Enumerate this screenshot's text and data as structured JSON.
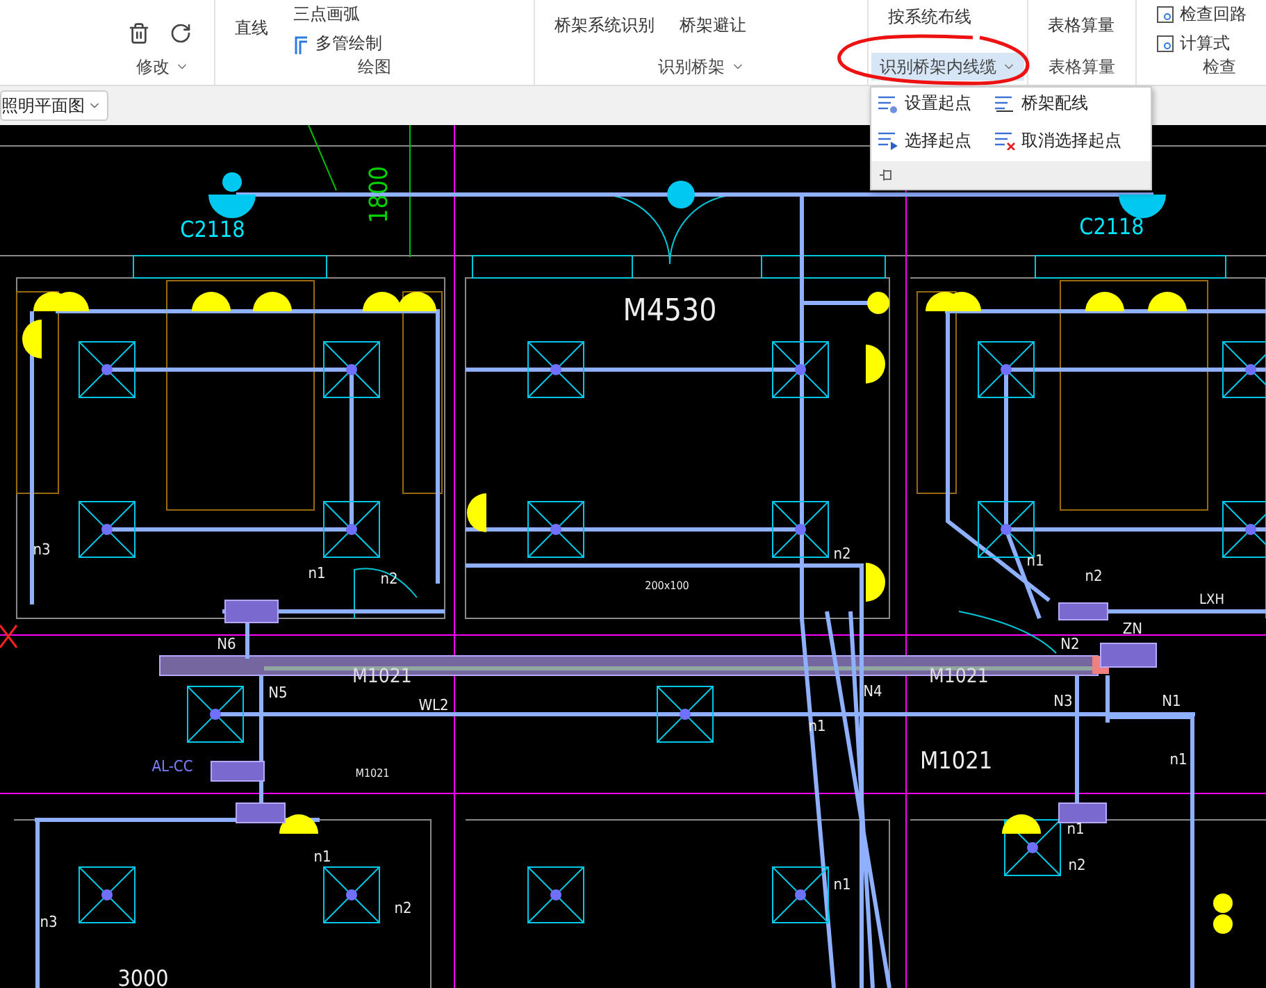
{
  "ribbon": {
    "groups": [
      {
        "label": "修改",
        "menu": true,
        "selected": false
      },
      {
        "label": "绘图",
        "menu": false,
        "selected": false,
        "tools": [
          "直线",
          "三点画弧",
          "多管绘制"
        ]
      },
      {
        "label": "识别桥架",
        "menu": true,
        "selected": false,
        "tools": [
          "桥架系统识别",
          "桥架避让"
        ]
      },
      {
        "label": "识别桥架内线缆",
        "menu": true,
        "selected": true,
        "tools": [
          "按系统布线"
        ]
      },
      {
        "label": "表格算量",
        "menu": false,
        "selected": false,
        "tools": [
          "表格算量"
        ]
      },
      {
        "label": "检查",
        "menu": false,
        "selected": false,
        "tools": [
          "检查回路",
          "计算式"
        ]
      }
    ]
  },
  "toolbar": {
    "floor_select": {
      "value": "照明平面图"
    }
  },
  "menu": {
    "items": [
      "设置起点",
      "桥架配线",
      "选择起点",
      "取消选择起点"
    ]
  },
  "canvas": {
    "labels": [
      "C2118",
      "1800",
      "M4530",
      "C2118",
      "n3",
      "n1",
      "n2",
      "n2",
      "n1",
      "n2",
      "200x100",
      "LXH",
      "N6",
      "M1021",
      "N5",
      "WL2",
      "AL-CC",
      "M1021",
      "N2",
      "ZN",
      "N4",
      "M1021",
      "N3",
      "N1",
      "n1",
      "M1021",
      "n1",
      "n1",
      "n1",
      "n3",
      "n2",
      "n1",
      "n2",
      "3000"
    ]
  }
}
